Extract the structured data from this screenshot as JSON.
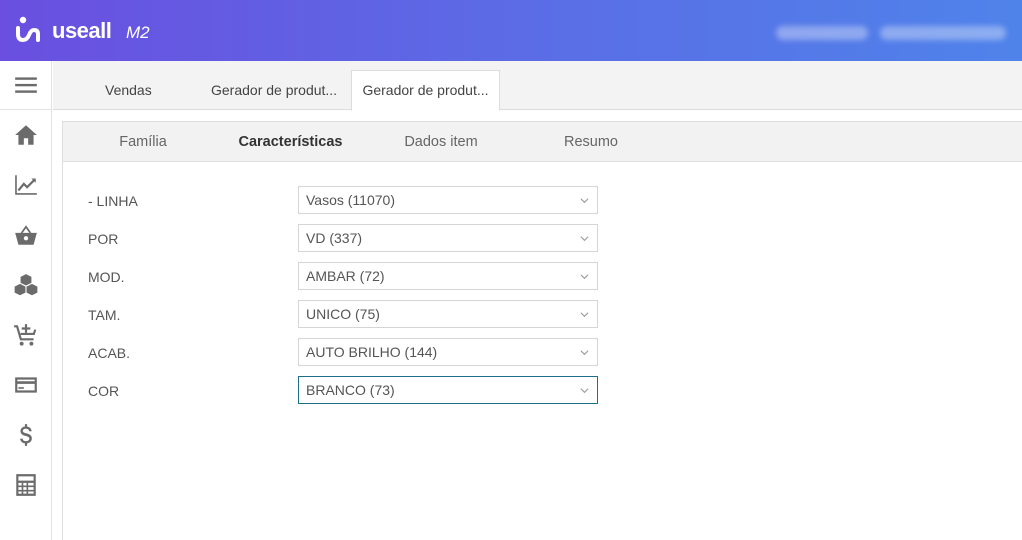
{
  "header": {
    "brand": "useall",
    "product": "M2",
    "colors": {
      "gradient_start": "#6a4fe0",
      "gradient_end": "#4f83ea"
    }
  },
  "sidebar": {
    "items": [
      {
        "icon": "menu-icon"
      },
      {
        "icon": "home-icon"
      },
      {
        "icon": "chart-icon"
      },
      {
        "icon": "basket-icon"
      },
      {
        "icon": "boxes-icon"
      },
      {
        "icon": "cart-add-icon"
      },
      {
        "icon": "card-icon"
      },
      {
        "icon": "dollar-icon"
      },
      {
        "icon": "calculator-icon"
      }
    ]
  },
  "tabs": [
    {
      "label": "Vendas",
      "active": false
    },
    {
      "label": "Gerador de produt...",
      "active": false
    },
    {
      "label": "Gerador de produt...",
      "active": true
    }
  ],
  "steps": [
    {
      "label": "Família",
      "active": false
    },
    {
      "label": "Características",
      "active": true
    },
    {
      "label": "Dados item",
      "active": false
    },
    {
      "label": "Resumo",
      "active": false
    }
  ],
  "form": {
    "rows": [
      {
        "label": "- LINHA",
        "value": "Vasos (11070)"
      },
      {
        "label": "POR",
        "value": "VD (337)"
      },
      {
        "label": "MOD.",
        "value": "AMBAR (72)"
      },
      {
        "label": "TAM.",
        "value": "UNICO (75)"
      },
      {
        "label": "ACAB.",
        "value": "AUTO BRILHO (144)"
      },
      {
        "label": "COR",
        "value": "BRANCO (73)"
      }
    ],
    "focus_color": "#1f6f8b"
  }
}
